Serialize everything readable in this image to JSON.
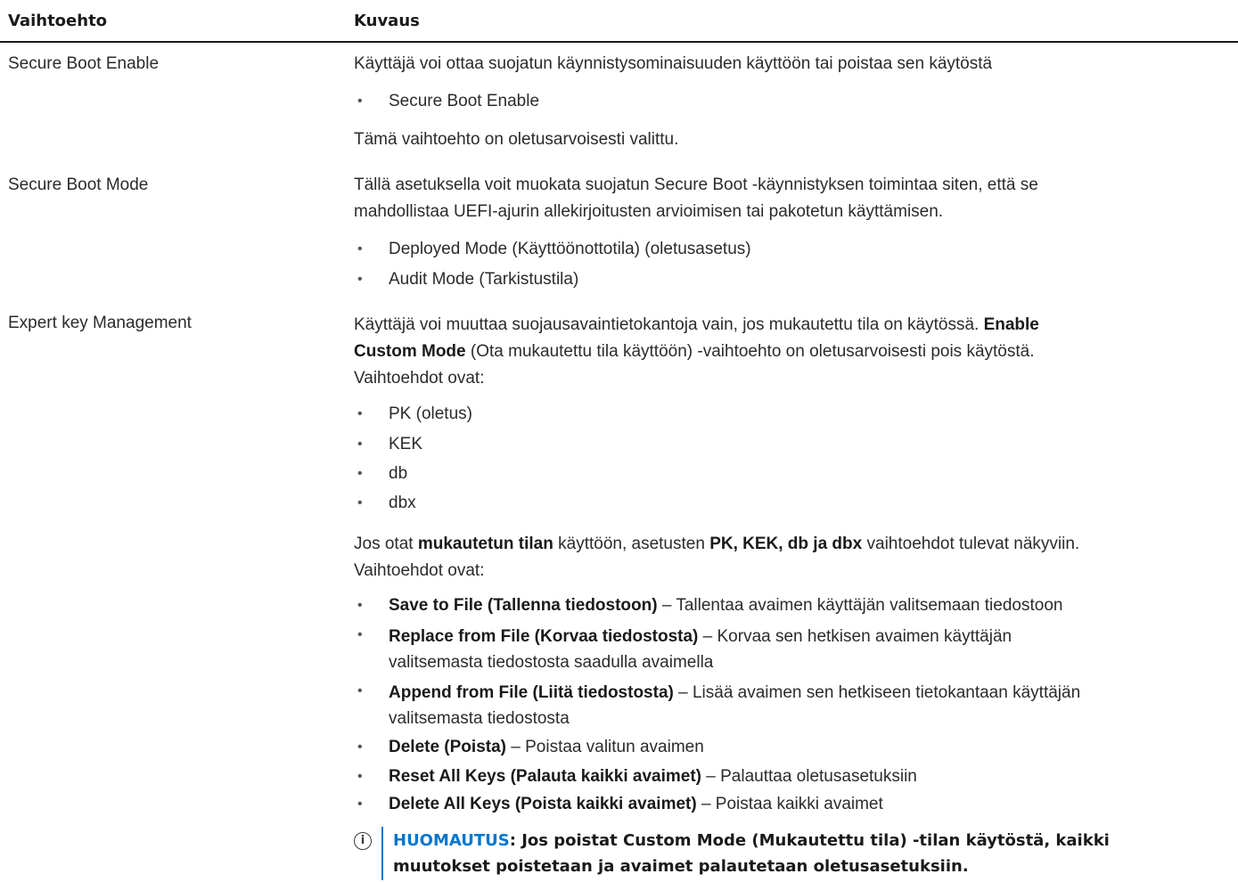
{
  "table": {
    "headers": [
      "Vaihtoehto",
      "Kuvaus"
    ],
    "rows": [
      {
        "option": "Secure Boot Enable",
        "description": "Käyttäjä voi ottaa suojatun käynnistysominaisuuden käyttöön tai poistaa sen käytöstä",
        "bullets": [
          "Secure Boot Enable"
        ],
        "footer": "Tämä vaihtoehto on oletusarvoisesti valittu."
      },
      {
        "option": "Secure Boot Mode",
        "description_line1": "Tällä asetuksella voit muokata suojatun Secure Boot -käynnistyksen toimintaa siten, että se",
        "description_line2": "mahdollistaa UEFI-ajurin allekirjoitusten arvioimisen tai pakotetun käyttämisen.",
        "bullets": [
          "Deployed Mode (Käyttöönottotila) (oletusasetus)",
          "Audit Mode (Tarkistustila)"
        ]
      },
      {
        "option": "Expert key Management",
        "intro_a": "Käyttäjä voi muuttaa suojausavaintietokantoja vain, jos mukautettu tila on käytössä. ",
        "intro_bold1": "Enable",
        "intro_bold2": "Custom Mode",
        "intro_b": " (Ota mukautettu tila käyttöön) -vaihtoehto on oletusarvoisesti pois käytöstä.",
        "intro_c": "Vaihtoehdot ovat:",
        "bullets": [
          "PK (oletus)",
          "KEK",
          "db",
          "dbx"
        ],
        "custom_a": "Jos otat ",
        "custom_bold1": "mukautetun tilan",
        "custom_b": " käyttöön, asetusten ",
        "custom_bold2": "PK, KEK, db ja dbx",
        "custom_c": " vaihtoehdot tulevat näkyviin.",
        "custom_d": "Vaihtoehdot ovat:",
        "actions": [
          {
            "name": "Save to File (Tallenna tiedostoon)",
            "desc": " – Tallentaa avaimen käyttäjän valitsemaan tiedostoon"
          },
          {
            "name": "Replace from File (Korvaa tiedostosta)",
            "desc": " – Korvaa sen hetkisen avaimen käyttäjän",
            "desc2": "valitsemasta tiedostosta saadulla avaimella"
          },
          {
            "name": "Append from File (Liitä tiedostosta)",
            "desc": " – Lisää avaimen sen hetkiseen tietokantaan käyttäjän",
            "desc2": "valitsemasta tiedostosta"
          },
          {
            "name": "Delete (Poista)",
            "desc": " – Poistaa valitun avaimen"
          },
          {
            "name": "Reset All Keys (Palauta kaikki avaimet)",
            "desc": " – Palauttaa oletusasetuksiin"
          },
          {
            "name": "Delete All Keys (Poista kaikki avaimet)",
            "desc": " – Poistaa kaikki avaimet"
          }
        ],
        "note_label": "HUOMAUTUS",
        "note_line1": ": Jos poistat Custom Mode (Mukautettu tila) -tilan käytöstä, kaikki",
        "note_line2": "muutokset poistetaan ja avaimet palautetaan oletusasetuksiin."
      }
    ]
  },
  "icons": {
    "note": "info-icon",
    "bullet": "•",
    "info_glyph": "i"
  },
  "colors": {
    "note_accent": "#0076ce",
    "text": "#2b2b2b"
  }
}
